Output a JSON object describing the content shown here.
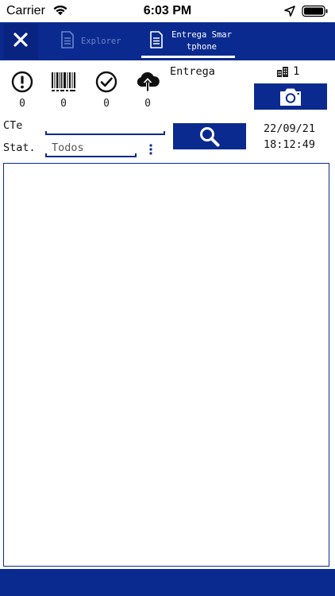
{
  "status_bar": {
    "carrier": "Carrier",
    "time": "6:03 PM",
    "wifi_icon": "wifi-icon",
    "location_icon": "location-arrow-icon",
    "battery_icon": "battery-icon"
  },
  "navbar": {
    "color": "#0a2a8f",
    "close_icon": "close-icon",
    "tabs": [
      {
        "label": "Explorer",
        "icon": "document-icon",
        "active": false
      },
      {
        "label": "Entrega Smartphone",
        "icon": "document-icon",
        "active": true
      }
    ]
  },
  "counters": [
    {
      "icon": "alert-circle-icon",
      "value": "0"
    },
    {
      "icon": "barcode-icon",
      "value": "0"
    },
    {
      "icon": "check-circle-icon",
      "value": "0"
    },
    {
      "icon": "cloud-upload-icon",
      "value": "0"
    }
  ],
  "entrega": {
    "label": "Entrega",
    "building_count": "1",
    "camera_icon": "camera-icon"
  },
  "filters": {
    "cte_label": "CTe",
    "cte_value": "",
    "stat_label": "Stat.",
    "stat_value": "Todos",
    "search_icon": "search-icon"
  },
  "datetime": {
    "date": "22/09/21",
    "time": "18:12:49"
  }
}
